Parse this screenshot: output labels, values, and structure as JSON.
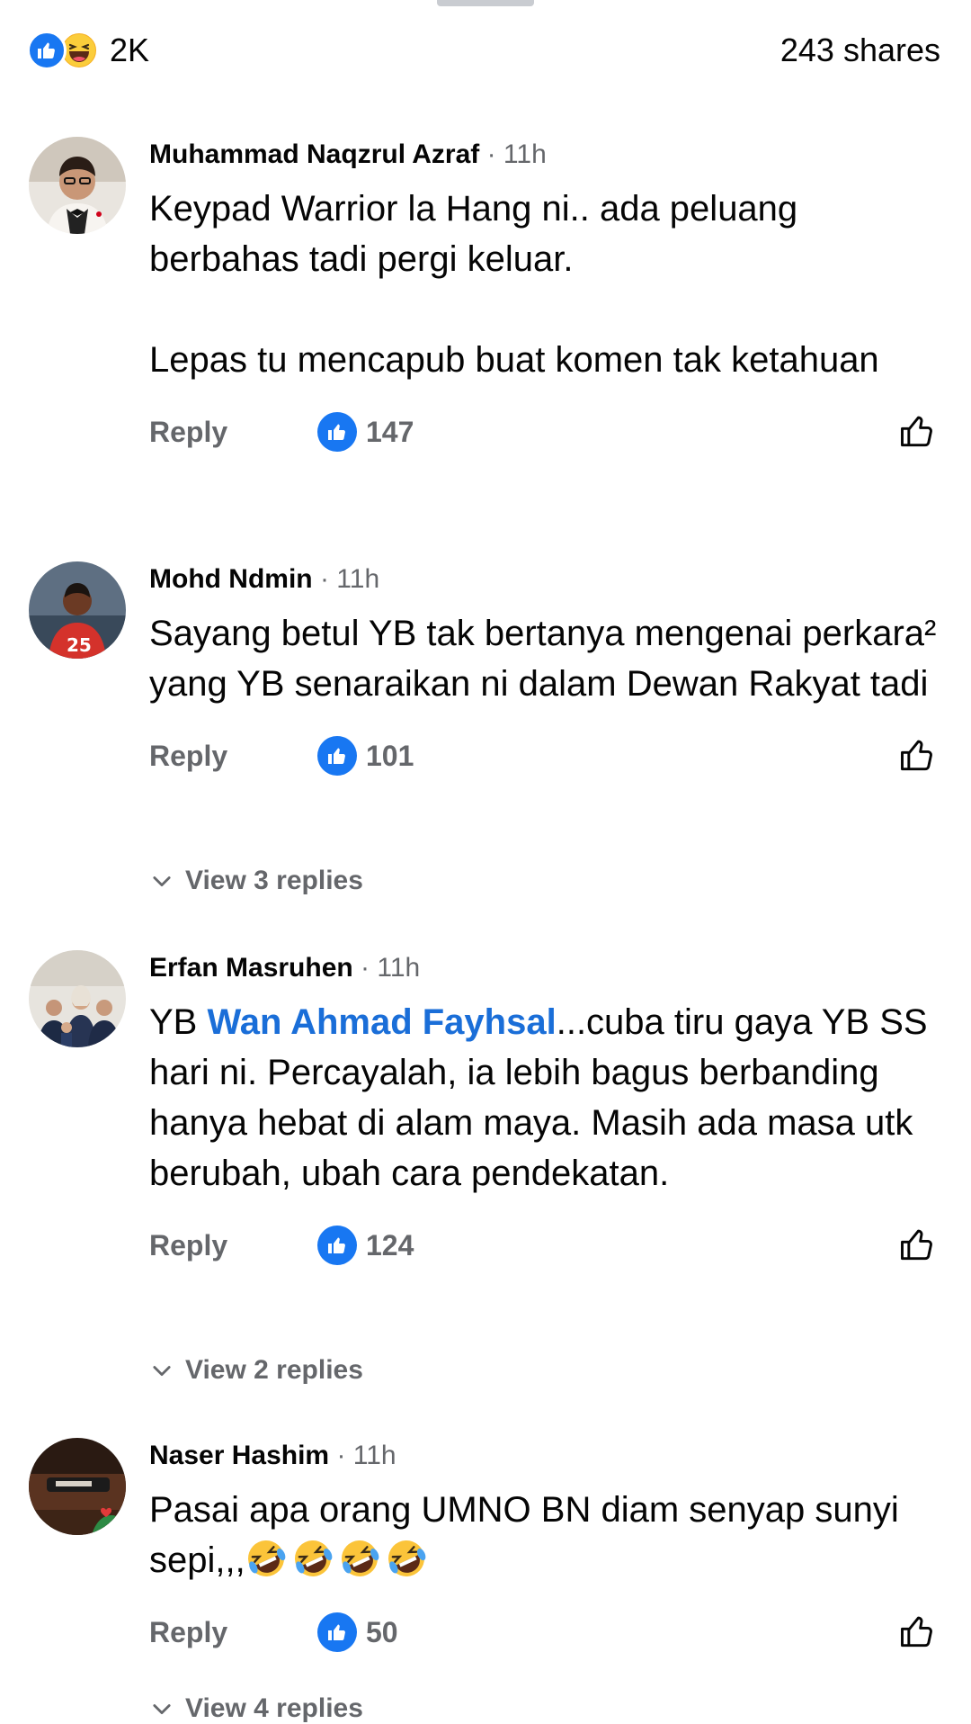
{
  "summary": {
    "reaction_count": "2K",
    "shares": "243 shares",
    "reaction_icons": [
      "like-icon",
      "haha-icon"
    ]
  },
  "colors": {
    "accent": "#1877f2",
    "mention": "#1a6ed8",
    "meta": "#65676b"
  },
  "comments": [
    {
      "name": "Muhammad Naqzrul Azraf",
      "time": " · 11h",
      "text": "Keypad Warrior la Hang ni.. ada peluang berbahas tadi pergi keluar.\n\nLepas tu mencapub buat komen tak ketahuan",
      "reply": "Reply",
      "likes": "147"
    },
    {
      "name": "Mohd Ndmin",
      "time": " · 11h",
      "text": "Sayang betul YB tak bertanya mengenai perkara² yang YB senaraikan ni dalam Dewan Rakyat tadi",
      "reply": "Reply",
      "likes": "101",
      "view_replies": "View 3 replies"
    },
    {
      "name": "Erfan Masruhen",
      "time": " · 11h",
      "text_prefix": "YB ",
      "mention": "Wan Ahmad Fayhsal",
      "text_suffix": "...cuba tiru gaya YB SS hari ni. Percayalah, ia lebih bagus berbanding hanya hebat di alam maya. Masih ada masa utk berubah, ubah cara pendekatan.",
      "reply": "Reply",
      "likes": "124",
      "view_replies": "View 2 replies"
    },
    {
      "name": "Naser Hashim",
      "time": " · 11h",
      "text": "Pasai apa orang UMNO BN diam senyap sunyi sepi,,,",
      "emoji": "rofl-icon",
      "reply": "Reply",
      "likes": "50",
      "view_replies": "View 4 replies"
    }
  ]
}
